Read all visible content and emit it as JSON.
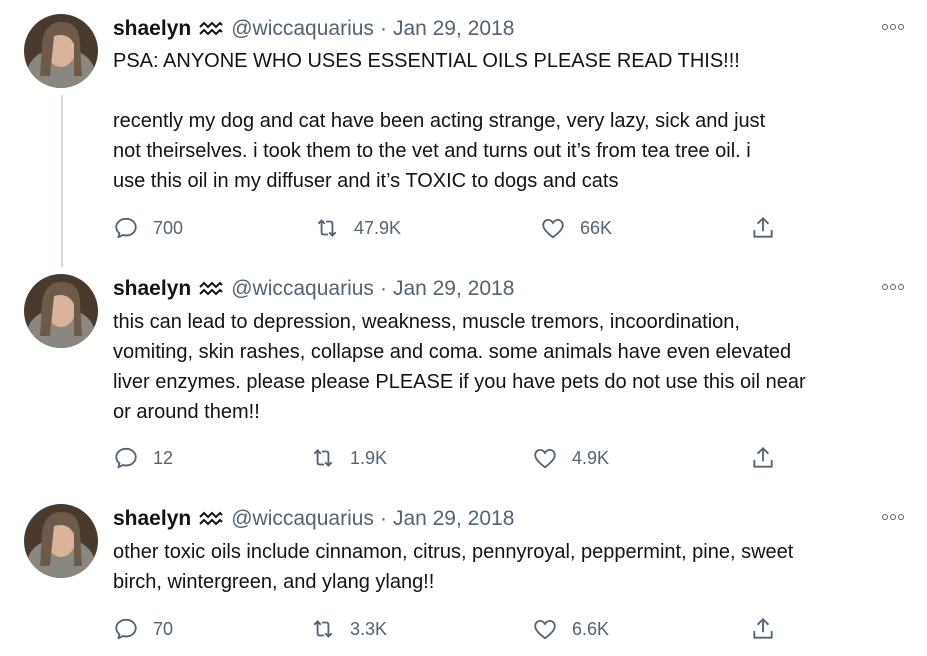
{
  "tweets": [
    {
      "name": "shaelyn",
      "handle": "@wiccaquarius",
      "separator": "·",
      "date": "Jan 29, 2018",
      "lines": [
        "PSA: ANYONE WHO USES ESSENTIAL OILS PLEASE READ THIS!!!",
        "",
        "recently my dog and cat have been acting strange, very lazy, sick and just",
        "not theirselves. i took them to the vet and turns out it’s from tea tree oil. i",
        "use this oil in my diffuser and it’s TOXIC to dogs and cats"
      ],
      "replies": "700",
      "retweets": "47.9K",
      "likes": "66K"
    },
    {
      "name": "shaelyn",
      "handle": "@wiccaquarius",
      "separator": "·",
      "date": "Jan 29, 2018",
      "lines": [
        "this can lead to depression, weakness, muscle tremors, incoordination,",
        "vomiting, skin rashes, collapse and coma. some animals have even elevated",
        "liver enzymes. please please PLEASE if you have pets do not use this oil near",
        "or around them!!"
      ],
      "replies": "12",
      "retweets": "1.9K",
      "likes": "4.9K"
    },
    {
      "name": "shaelyn",
      "handle": "@wiccaquarius",
      "separator": "·",
      "date": "Jan 29, 2018",
      "lines": [
        "other toxic oils include cinnamon, citrus, pennyroyal, peppermint, pine, sweet",
        "birch, wintergreen, and ylang ylang!!"
      ],
      "replies": "70",
      "retweets": "3.3K",
      "likes": "6.6K"
    }
  ],
  "icons": {
    "name_emoji": "aquarius-icon",
    "more": "more-icon",
    "reply": "reply-icon",
    "retweet": "retweet-icon",
    "like": "heart-icon",
    "share": "share-icon"
  },
  "colors": {
    "text": "#0f1419",
    "secondary": "#536471",
    "thread_line": "#cfd9de"
  }
}
